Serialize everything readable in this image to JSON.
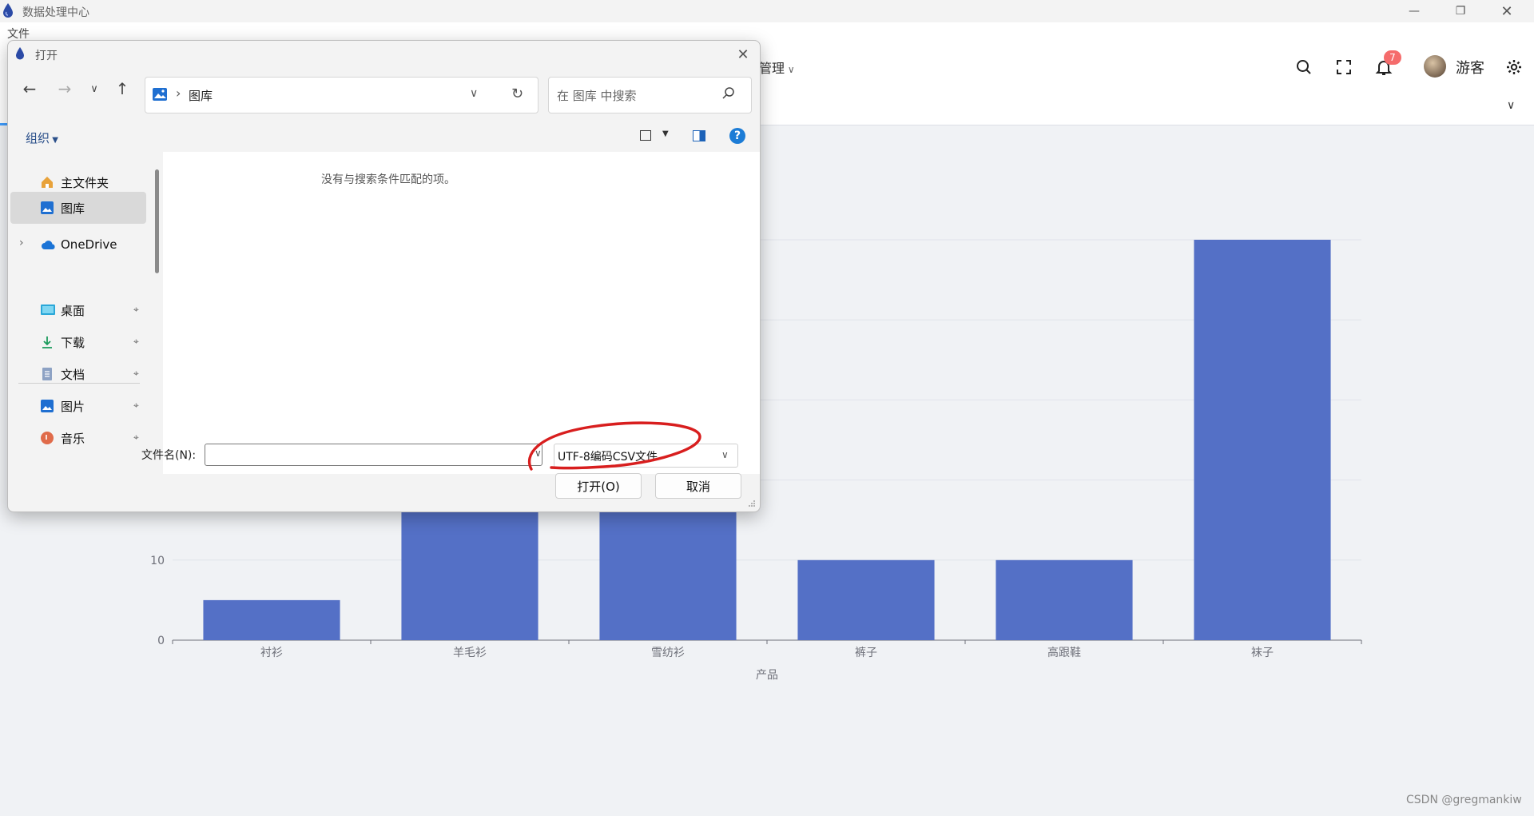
{
  "app": {
    "title": "数据处理中心",
    "menu_file": "文件",
    "nav_management": "管理",
    "notification_count": "7",
    "username": "游客"
  },
  "chart_data": {
    "type": "bar",
    "categories": [
      "衬衫",
      "羊毛衫",
      "雪纺衫",
      "裤子",
      "高跟鞋",
      "袜子"
    ],
    "values": [
      5,
      20,
      36,
      10,
      10,
      50
    ],
    "xlabel": "产品",
    "ylabel": "",
    "ylim": [
      0,
      50
    ],
    "yticks": [
      "0",
      "10"
    ],
    "grid": true,
    "bar_color": "#5470c6"
  },
  "dialog": {
    "title": "打开",
    "address": "图库",
    "search_placeholder": "在 图库 中搜索",
    "organize_label": "组织",
    "help_label": "?",
    "empty_message": "没有与搜索条件匹配的项。",
    "nav_items": [
      {
        "label": "主文件夹",
        "icon": "home-icon"
      },
      {
        "label": "图库",
        "icon": "gallery-icon"
      },
      {
        "label": "OneDrive",
        "icon": "cloud-icon"
      },
      {
        "label": "桌面",
        "icon": "desktop-icon"
      },
      {
        "label": "下载",
        "icon": "download-icon"
      },
      {
        "label": "文档",
        "icon": "document-icon"
      },
      {
        "label": "图片",
        "icon": "pictures-icon"
      },
      {
        "label": "音乐",
        "icon": "music-icon"
      }
    ],
    "filename_label": "文件名(N):",
    "filename_value": "",
    "filetype_selected": "UTF-8编码CSV文件",
    "open_button": "打开(O)",
    "cancel_button": "取消"
  },
  "watermark": "CSDN @gregmankiw",
  "colors": {
    "accent": "#409eff",
    "bar": "#5470c6",
    "badge": "#f56c6c",
    "annotation": "#d81e1e"
  }
}
